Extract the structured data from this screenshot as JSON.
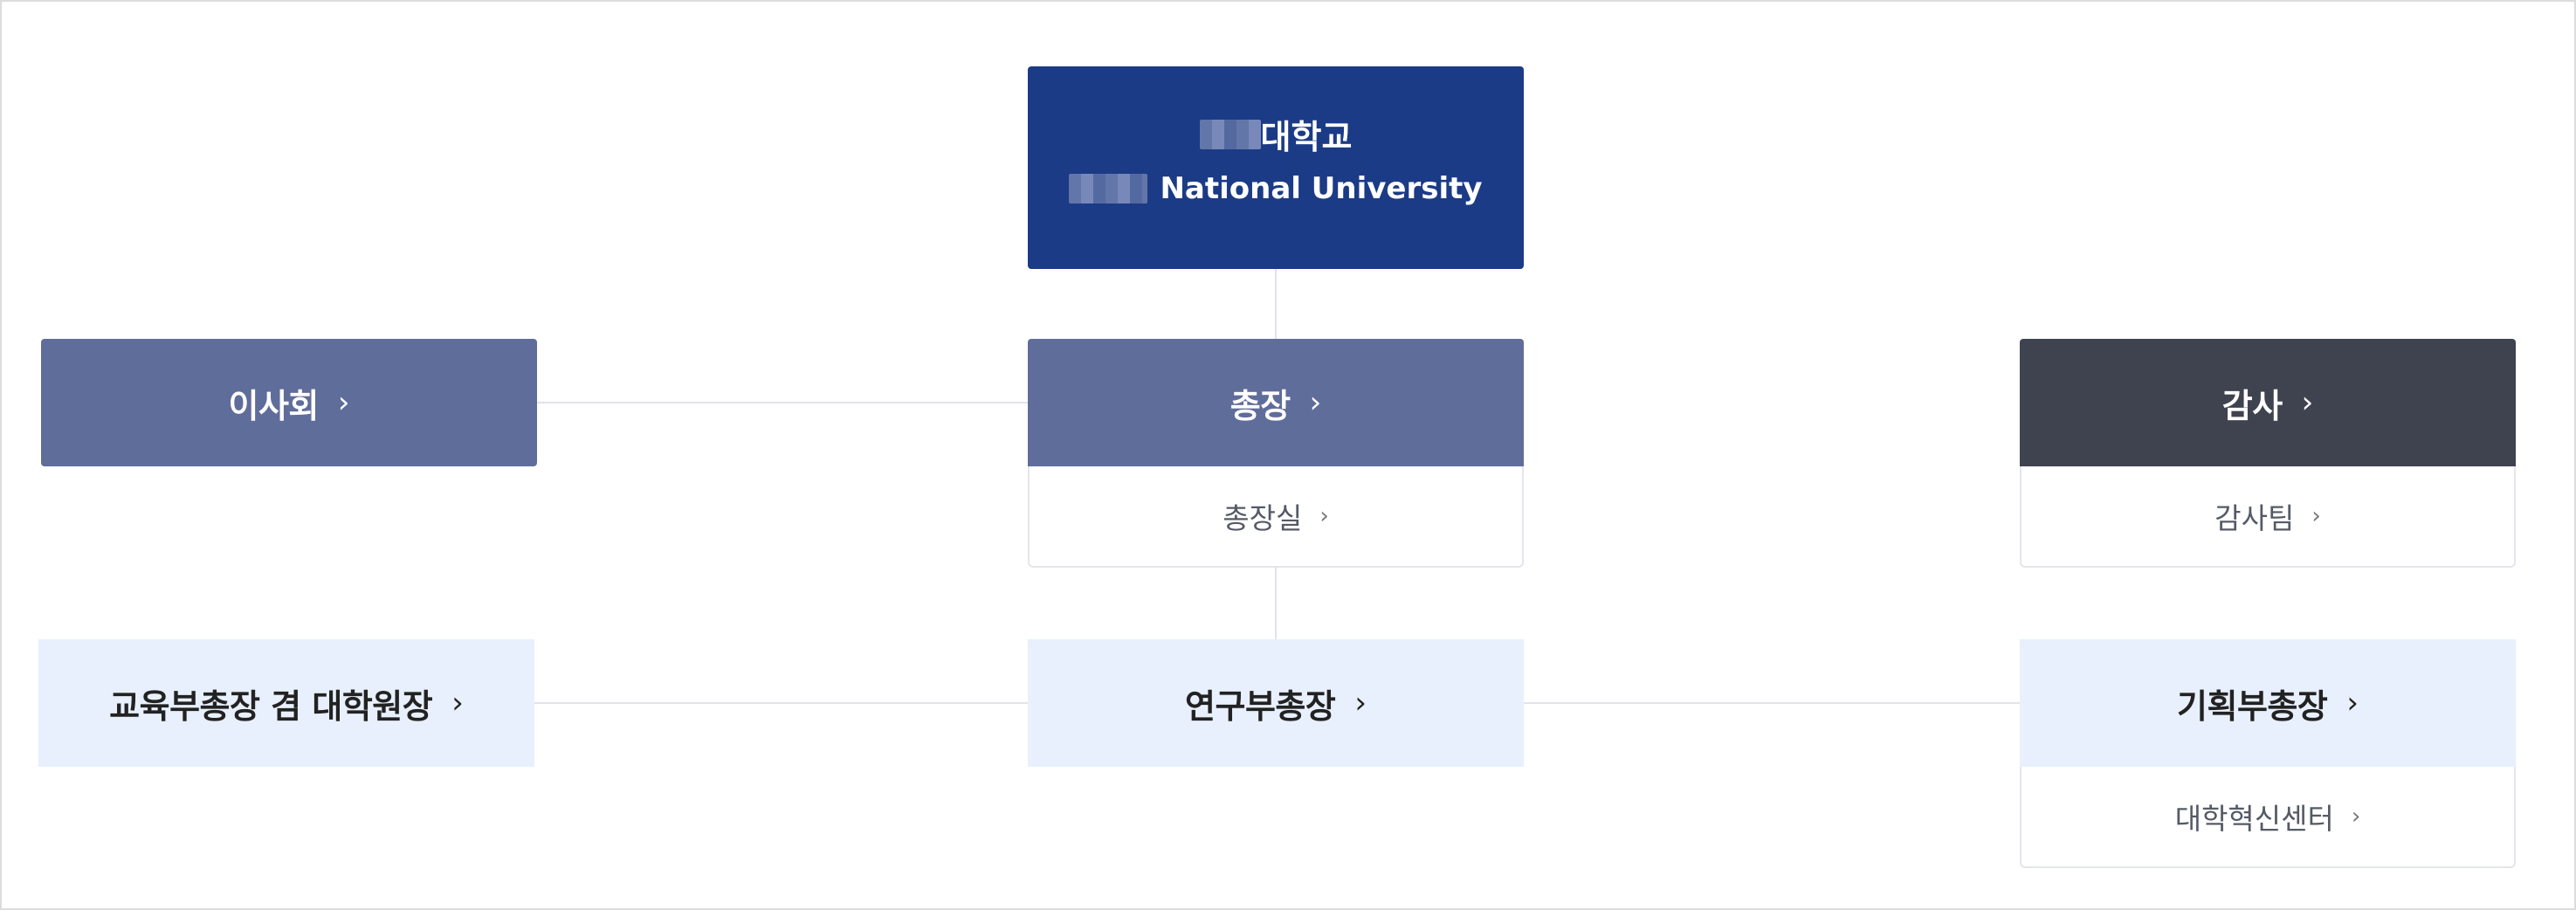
{
  "org": {
    "root": {
      "name_ko": "대학교",
      "name_en": "National University"
    },
    "board": {
      "label": "이사회"
    },
    "president": {
      "label": "총장",
      "sub": "총장실"
    },
    "audit": {
      "label": "감사",
      "sub": "감사팀"
    },
    "vp_education": {
      "label": "교육부총장 겸 대학원장"
    },
    "vp_research": {
      "label": "연구부총장"
    },
    "vp_planning": {
      "label": "기획부총장",
      "sub": "대학혁신센터"
    }
  },
  "chevron": "›",
  "colors": {
    "root": "#1c3b86",
    "primary": "#5f6d9a",
    "audit": "#3f4350",
    "vp": "#e8f0fd",
    "connector": "#e2e3e8"
  }
}
